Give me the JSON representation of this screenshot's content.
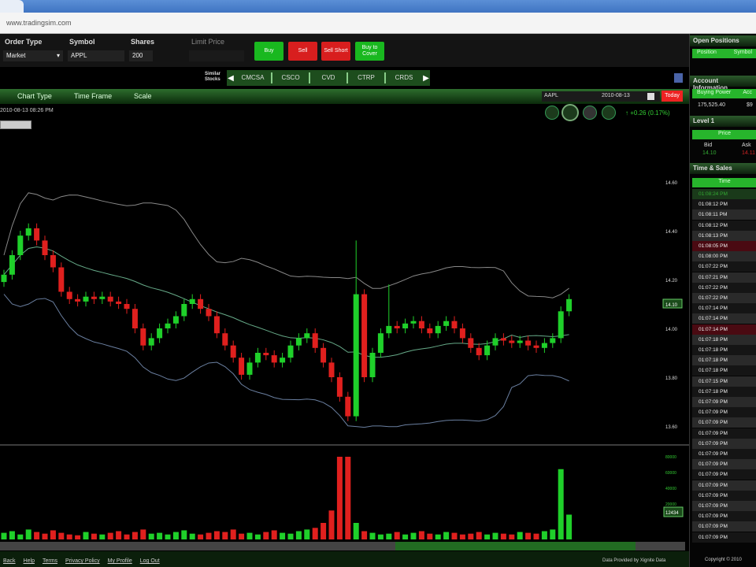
{
  "browser": {
    "url": "www.tradingsim.com"
  },
  "order": {
    "order_type_label": "Order Type",
    "order_type": "Market",
    "symbol_label": "Symbol",
    "symbol": "APPL",
    "shares_label": "Shares",
    "shares": "200",
    "limit_label": "Limit Price",
    "buttons": [
      "Buy",
      "Sell",
      "Sell Short",
      "Buy to Cover"
    ]
  },
  "similar": {
    "label": "Similar Stocks",
    "tabs": [
      "CMCSA",
      "CSCO",
      "CVD",
      "CTRP",
      "CRDS"
    ]
  },
  "chart_toolbar": {
    "items": [
      "Chart Type",
      "Time Frame",
      "Scale"
    ],
    "symbol": "AAPL",
    "date": "2010-08-13",
    "today": "Today",
    "change": "↑ +0.26 (0.17%)"
  },
  "timestamp": "2010-08-13 08:26 PM",
  "chart_data": {
    "type": "candlestick",
    "ylim": [
      13.55,
      14.7
    ],
    "yticks": [
      "14.60",
      "14.40",
      "14.20",
      "14.00",
      "13.80",
      "13.60"
    ],
    "current_price": "14.10",
    "closes": [
      14.22,
      14.3,
      14.38,
      14.41,
      14.36,
      14.3,
      14.25,
      14.15,
      14.12,
      14.11,
      14.13,
      14.12,
      14.13,
      14.11,
      14.1,
      14.08,
      14.0,
      13.93,
      13.96,
      14.0,
      14.02,
      14.05,
      14.1,
      14.12,
      14.08,
      14.05,
      13.98,
      13.93,
      13.88,
      13.81,
      13.86,
      13.9,
      13.89,
      13.86,
      13.88,
      13.93,
      13.96,
      13.98,
      13.92,
      13.86,
      13.8,
      13.72,
      13.64,
      14.14,
      13.8,
      13.9,
      13.98,
      14.01,
      14.0,
      14.02,
      14.03,
      14.0,
      13.98,
      14.01,
      14.03,
      14.0,
      13.96,
      13.92,
      13.89,
      13.93,
      13.96,
      13.95,
      13.94,
      13.95,
      13.93,
      13.92,
      13.94,
      13.96,
      14.07,
      14.12
    ],
    "volumes": [
      8,
      10,
      6,
      12,
      9,
      7,
      11,
      8,
      6,
      5,
      9,
      7,
      6,
      8,
      10,
      6,
      9,
      12,
      7,
      8,
      6,
      9,
      11,
      7,
      6,
      8,
      10,
      9,
      12,
      7,
      8,
      6,
      9,
      11,
      8,
      7,
      10,
      12,
      14,
      20,
      35,
      100,
      100,
      20,
      10,
      8,
      6,
      7,
      9,
      6,
      8,
      10,
      7,
      6,
      9,
      8,
      6,
      7,
      9,
      6,
      8,
      7,
      6,
      9,
      8,
      7,
      10,
      12,
      85,
      30
    ],
    "volume_ticks": [
      "80000",
      "60000",
      "40000",
      "20000"
    ],
    "volume_current": "12434"
  },
  "right": {
    "open_positions": "Open Positions",
    "pos_cols": [
      "Position",
      "Symbol"
    ],
    "account": "Account Information",
    "acc_cols": [
      "Buying Power",
      "Acc"
    ],
    "buying_power": "175,525.40",
    "acc_val": "$9",
    "level1": "Level 1",
    "price": "Price",
    "bid": "Bid",
    "ask": "Ask",
    "bid_val": "14.10",
    "ask_val": "14.11",
    "ts_title": "Time & Sales",
    "ts_col": "Time",
    "ts": [
      "01:08:24 PM",
      "01:08:12 PM",
      "01:08:11 PM",
      "01:08:12 PM",
      "01:08:13 PM",
      "01:08:05 PM",
      "01:08:00 PM",
      "01:07:22 PM",
      "01:07:21 PM",
      "01:07:22 PM",
      "01:07:22 PM",
      "01:07:14 PM",
      "01:07:14 PM",
      "01:07:14 PM",
      "01:07:18 PM",
      "01:07:18 PM",
      "01:07:18 PM",
      "01:07:18 PM",
      "01:07:15 PM",
      "01:07:18 PM",
      "01:07:09 PM",
      "01:07:09 PM",
      "01:07:09 PM",
      "01:07:09 PM",
      "01:07:09 PM",
      "01:07:09 PM",
      "01:07:09 PM",
      "01:07:09 PM",
      "01:07:09 PM",
      "01:07:09 PM",
      "01:07:09 PM",
      "01:07:09 PM",
      "01:07:09 PM",
      "01:07:09 PM"
    ]
  },
  "footer": {
    "links": [
      "Back",
      "Help",
      "Terms",
      "Privacy Policy",
      "My Profile",
      "Log Out"
    ],
    "provider": "Data Provided by Xignite Data",
    "copyright": "Copyright © 2010"
  }
}
